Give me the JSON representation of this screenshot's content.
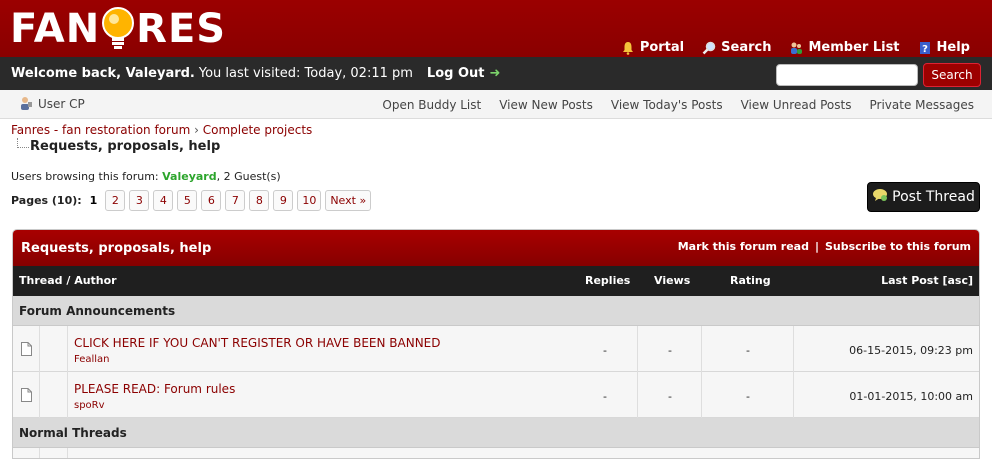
{
  "header": {
    "logo_left": "FAN",
    "logo_right": "RES",
    "links": [
      {
        "label": "Portal",
        "icon": "bell-icon"
      },
      {
        "label": "Search",
        "icon": "magnifier-icon"
      },
      {
        "label": "Member List",
        "icon": "members-icon"
      },
      {
        "label": "Help",
        "icon": "help-icon"
      }
    ]
  },
  "welcome": {
    "greeting": "Welcome back, Valeyard.",
    "last_visit": "You last visited: Today, 02:11 pm",
    "logout": "Log Out",
    "search_placeholder": "",
    "search_button": "Search"
  },
  "navbar": {
    "usercp": "User CP",
    "links": [
      "Open Buddy List",
      "View New Posts",
      "View Today's Posts",
      "View Unread Posts",
      "Private Messages"
    ]
  },
  "breadcrumb": {
    "root": "Fanres - fan restoration forum",
    "sep": "›",
    "parent": "Complete projects",
    "current": "Requests, proposals, help"
  },
  "browsing": {
    "prefix": "Users browsing this forum:",
    "user": "Valeyard",
    "suffix": ", 2 Guest(s)"
  },
  "pagination": {
    "label": "Pages (10):",
    "current": "1",
    "pages": [
      "2",
      "3",
      "4",
      "5",
      "6",
      "7",
      "8",
      "9",
      "10"
    ],
    "next": "Next »"
  },
  "post_thread": "Post Thread",
  "forum": {
    "title": "Requests, proposals, help",
    "mark_read": "Mark this forum read",
    "separator": "|",
    "subscribe": "Subscribe to this forum",
    "columns": {
      "thread": "Thread / Author",
      "replies": "Replies",
      "views": "Views",
      "rating": "Rating",
      "last_post": "Last Post [asc]"
    },
    "sections": {
      "announcements": "Forum Announcements",
      "normal": "Normal Threads"
    },
    "announcements": [
      {
        "title": "CLICK HERE IF YOU CAN'T REGISTER OR HAVE BEEN BANNED",
        "author": "Feallan",
        "replies": "-",
        "views": "-",
        "rating": "-",
        "last_post": "06-15-2015, 09:23 pm"
      },
      {
        "title": "PLEASE READ: Forum rules",
        "author": "spoRv",
        "replies": "-",
        "views": "-",
        "rating": "-",
        "last_post": "01-01-2015, 10:00 am"
      }
    ]
  }
}
